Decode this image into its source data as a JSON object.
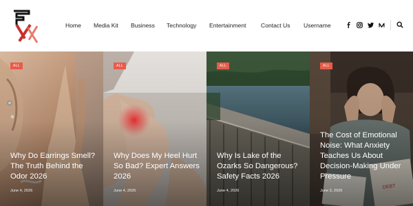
{
  "nav": {
    "items": [
      "Home",
      "Media Kit",
      "Business",
      "Technology",
      "Entertainment",
      "Contact Us",
      "Username"
    ]
  },
  "social": [
    "facebook-icon",
    "instagram-icon",
    "twitter-icon",
    "medium-icon"
  ],
  "colors": {
    "accent": "#e85c4a",
    "logo_red": "#c9302c"
  },
  "cards": [
    {
      "badge": "ALL",
      "title": "Why Do Earrings Smell? The Truth Behind the Odor 2026",
      "date": "June 4, 2026"
    },
    {
      "badge": "ALL",
      "title": "Why Does My Heel Hurt So Bad? Expert Answers 2026",
      "date": "June 4, 2026"
    },
    {
      "badge": "ALL",
      "title": "Why Is Lake of the Ozarks So Dangerous? Safety Facts 2026",
      "date": "June 4, 2026"
    },
    {
      "badge": "ALL",
      "title": "The Cost of Emotional Noise: What Anxiety Teaches Us About Decision-Making Under Pressure",
      "date": "June 3, 2026"
    }
  ]
}
